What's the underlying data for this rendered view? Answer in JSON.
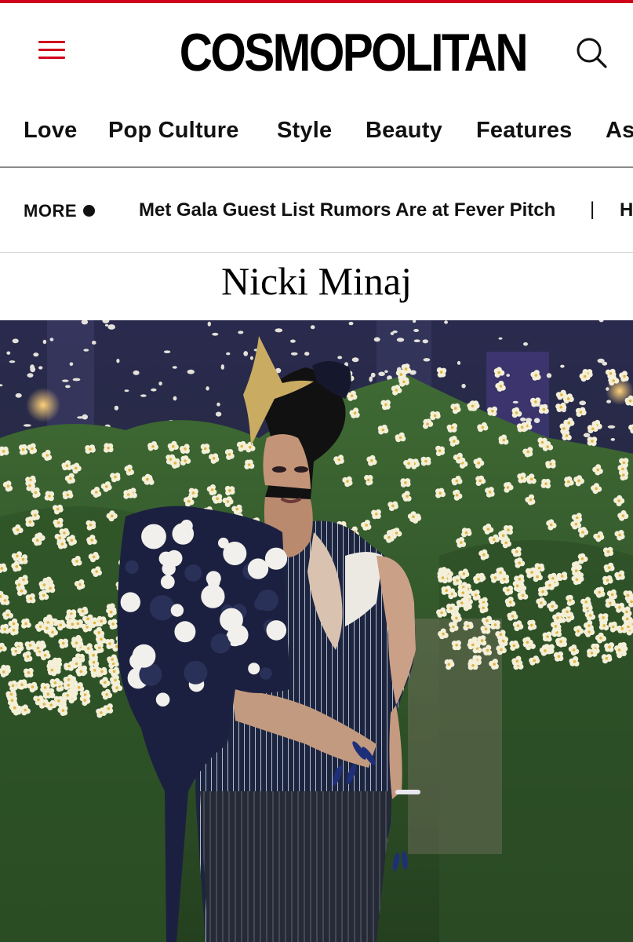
{
  "brand": {
    "name": "COSMOPOLITAN",
    "accent_color": "#d0021b"
  },
  "header": {
    "menu_icon": "hamburger-menu-icon",
    "search_icon": "search-icon"
  },
  "nav": {
    "items": [
      {
        "label": "Love"
      },
      {
        "label": "Pop Culture"
      },
      {
        "label": "Style"
      },
      {
        "label": "Beauty"
      },
      {
        "label": "Features"
      },
      {
        "label": "As"
      }
    ]
  },
  "ticker": {
    "more_label": "MORE",
    "headline": "Met Gala Guest List Rumors Are at Fever Pitch",
    "separator": "|",
    "next_headline": "H"
  },
  "article": {
    "title": "Nicki Minaj"
  }
}
